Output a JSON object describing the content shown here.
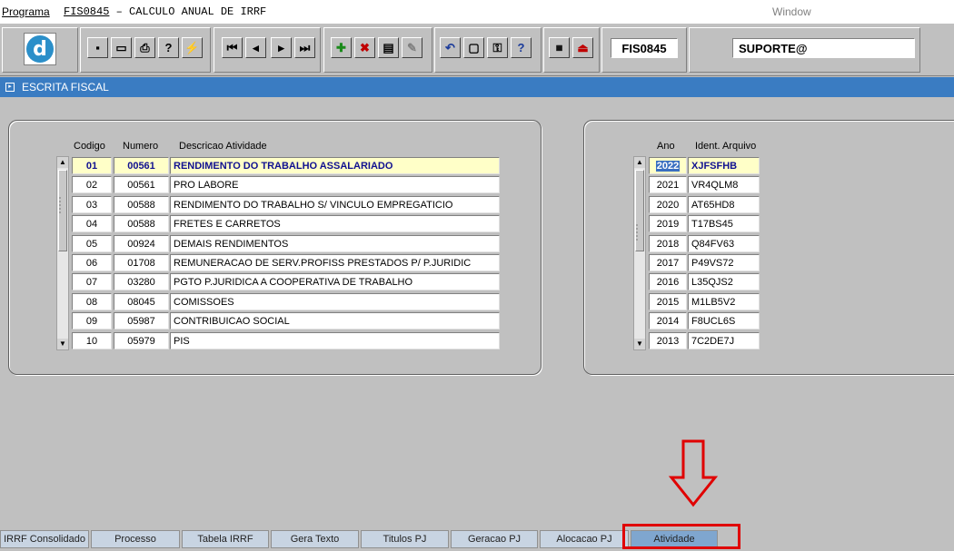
{
  "menubar": {
    "programa": "Programa",
    "title_code": "FIS0845",
    "title_rest": " – CALCULO ANUAL DE IRRF",
    "window": "Window"
  },
  "toolbar": {
    "program_code": "FIS0845",
    "user": "SUPORTE@"
  },
  "section": {
    "title": "ESCRITA FISCAL"
  },
  "activities": {
    "headers": {
      "codigo": "Codigo",
      "numero": "Numero",
      "descricao": "Descricao Atividade"
    },
    "rows": [
      {
        "codigo": "01",
        "numero": "00561",
        "descricao": "RENDIMENTO DO TRABALHO ASSALARIADO"
      },
      {
        "codigo": "02",
        "numero": "00561",
        "descricao": "PRO LABORE"
      },
      {
        "codigo": "03",
        "numero": "00588",
        "descricao": "RENDIMENTO DO TRABALHO S/ VINCULO EMPREGATICIO"
      },
      {
        "codigo": "04",
        "numero": "00588",
        "descricao": "FRETES E CARRETOS"
      },
      {
        "codigo": "05",
        "numero": "00924",
        "descricao": "DEMAIS RENDIMENTOS"
      },
      {
        "codigo": "06",
        "numero": "01708",
        "descricao": "REMUNERACAO DE SERV.PROFISS PRESTADOS P/ P.JURIDIC"
      },
      {
        "codigo": "07",
        "numero": "03280",
        "descricao": "PGTO P.JURIDICA A COOPERATIVA DE TRABALHO"
      },
      {
        "codigo": "08",
        "numero": "08045",
        "descricao": "COMISSOES"
      },
      {
        "codigo": "09",
        "numero": "05987",
        "descricao": "CONTRIBUICAO SOCIAL"
      },
      {
        "codigo": "10",
        "numero": "05979",
        "descricao": "PIS"
      }
    ]
  },
  "files": {
    "headers": {
      "ano": "Ano",
      "ident": "Ident. Arquivo"
    },
    "rows": [
      {
        "ano": "2022",
        "ident": "XJFSFHB"
      },
      {
        "ano": "2021",
        "ident": "VR4QLM8"
      },
      {
        "ano": "2020",
        "ident": "AT65HD8"
      },
      {
        "ano": "2019",
        "ident": "T17BS45"
      },
      {
        "ano": "2018",
        "ident": "Q84FV63"
      },
      {
        "ano": "2017",
        "ident": "P49VS72"
      },
      {
        "ano": "2016",
        "ident": "L35QJS2"
      },
      {
        "ano": "2015",
        "ident": "M1LB5V2"
      },
      {
        "ano": "2014",
        "ident": "F8UCL6S"
      },
      {
        "ano": "2013",
        "ident": "7C2DE7J"
      }
    ]
  },
  "tabs": [
    {
      "label": "IRRF Consolidado",
      "active": false
    },
    {
      "label": "Processo",
      "active": false
    },
    {
      "label": "Tabela IRRF",
      "active": false
    },
    {
      "label": "Gera Texto",
      "active": false
    },
    {
      "label": "Titulos PJ",
      "active": false
    },
    {
      "label": "Geracao PJ",
      "active": false
    },
    {
      "label": "Alocacao PJ",
      "active": false
    },
    {
      "label": "Atividade",
      "active": true
    }
  ],
  "colors": {
    "title_band": "#3a7cc2",
    "selected_row": "#ffffc8",
    "annotation": "#e00000"
  }
}
